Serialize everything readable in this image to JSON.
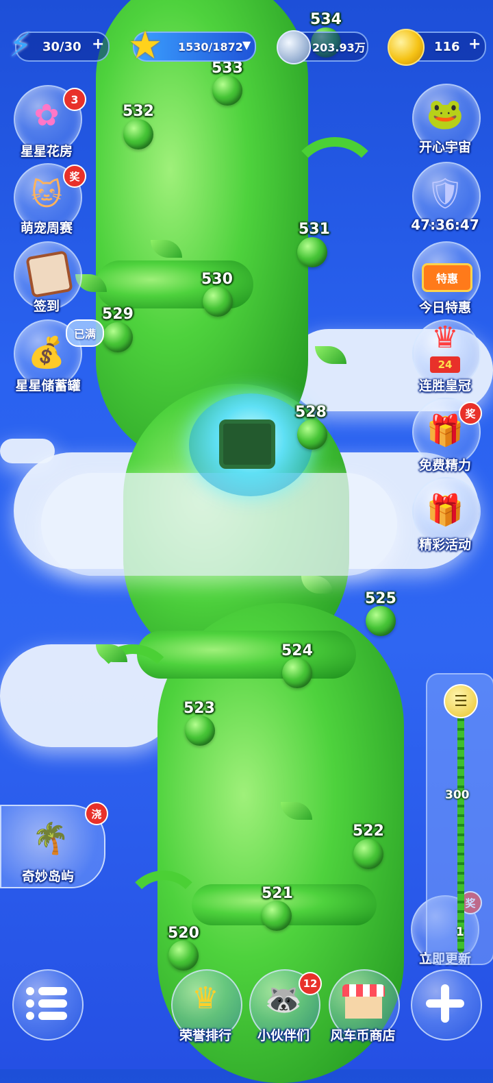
{
  "resources": {
    "energy": "30/30",
    "stars": "1530/1872",
    "silver": "203.93万",
    "gold": "116"
  },
  "levels": [
    "534",
    "533",
    "532",
    "531",
    "530",
    "529",
    "528",
    "525",
    "524",
    "523",
    "522",
    "521",
    "520"
  ],
  "left_buttons": {
    "flower_house": {
      "label": "星星花房",
      "badge": "3"
    },
    "pet_contest": {
      "label": "萌宠周赛",
      "badge": "奖"
    },
    "signin": {
      "label": "签到"
    },
    "piggy_bank": {
      "label": "星星储蓄罐",
      "tag": "已满"
    },
    "island": {
      "label": "奇妙岛屿",
      "badge": "浇"
    }
  },
  "right_buttons": {
    "happy_universe": {
      "label": "开心宇宙"
    },
    "timer": {
      "label": "47:36:47"
    },
    "today_deal": {
      "label": "今日特惠",
      "sign": "特惠"
    },
    "win_crown": {
      "label": "连胜皇冠",
      "number": "24"
    },
    "free_energy": {
      "label": "免费精力",
      "badge": "奖"
    },
    "events": {
      "label": "精彩活动"
    },
    "update": {
      "label": "立即更新",
      "badge": "奖"
    }
  },
  "scroller": {
    "top_label": "300",
    "bottom_label": "1"
  },
  "bottom_bar": {
    "ranking": {
      "label": "荣誉排行"
    },
    "partners": {
      "label": "小伙伴们",
      "badge": "12"
    },
    "shop": {
      "label": "风车币商店"
    }
  },
  "colors": {
    "sky": "#2a62f0",
    "vine": "#4ed23d",
    "badge": "#e8312a"
  }
}
